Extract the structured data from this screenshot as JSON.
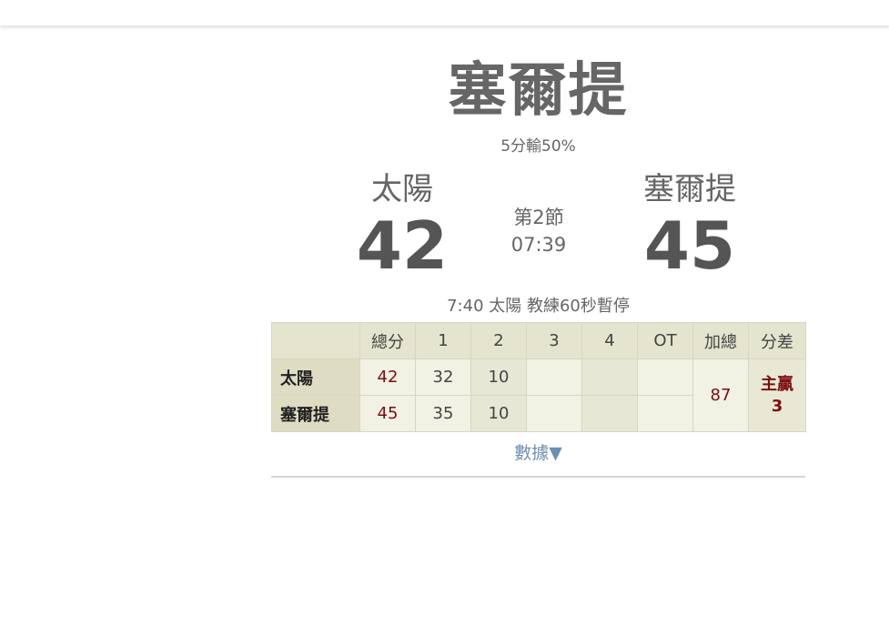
{
  "header": {
    "headline": "塞爾提",
    "subline": "5分輸50%"
  },
  "scoreboard": {
    "away": {
      "name": "太陽",
      "score": "42"
    },
    "home": {
      "name": "塞爾提",
      "score": "45"
    },
    "period": "第2節",
    "clock": "07:39"
  },
  "last_play": "7:40 太陽 教練60秒暫停",
  "box_score": {
    "columns": [
      "",
      "總分",
      "1",
      "2",
      "3",
      "4",
      "OT",
      "加總",
      "分差"
    ],
    "rows": [
      {
        "team": "太陽",
        "total": "42",
        "q1": "32",
        "q2": "10",
        "q3": "",
        "q4": "",
        "ot": ""
      },
      {
        "team": "塞爾提",
        "total": "45",
        "q1": "35",
        "q2": "10",
        "q3": "",
        "q4": "",
        "ot": ""
      }
    ],
    "combined": "87",
    "margin_label": "主贏",
    "margin_value": "3"
  },
  "stats_link": "數據▼",
  "colors": {
    "score_red": "#7a0f0f",
    "table_header_bg": "#e5e4cf",
    "link_blue": "#6b8fb0"
  }
}
